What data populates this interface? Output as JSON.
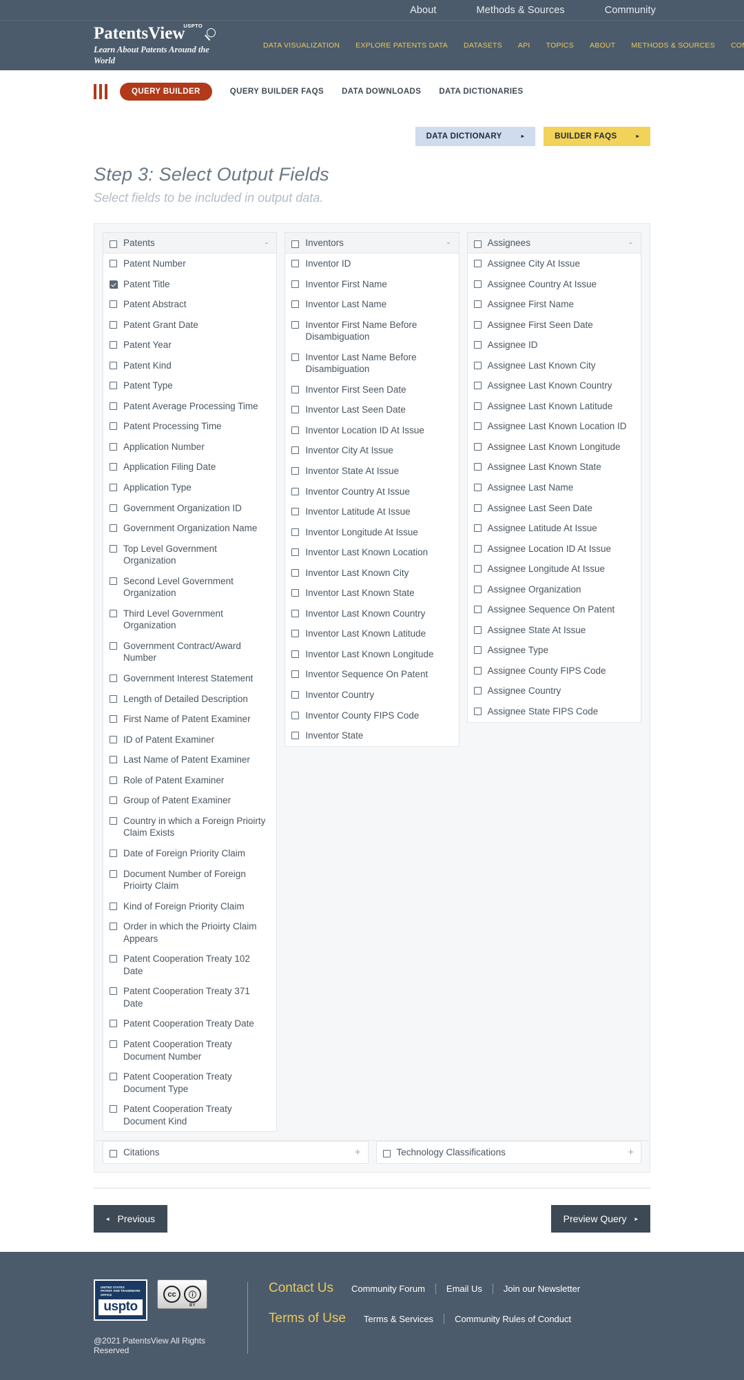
{
  "utility_nav": [
    {
      "label": "About"
    },
    {
      "label": "Methods & Sources"
    },
    {
      "label": "Community"
    }
  ],
  "brand": {
    "name": "PatentsView",
    "superscript": "USPTO",
    "tagline": "Learn About Patents Around the World"
  },
  "main_nav": [
    {
      "label": "DATA VISUALIZATION"
    },
    {
      "label": "EXPLORE PATENTS DATA"
    },
    {
      "label": "DATASETS"
    },
    {
      "label": "API"
    },
    {
      "label": "TOPICS"
    },
    {
      "label": "ABOUT"
    },
    {
      "label": "METHODS & SOURCES"
    },
    {
      "label": "COMMUNITY"
    }
  ],
  "subnav": {
    "active": "QUERY BUILDER",
    "links": [
      {
        "label": "QUERY BUILDER FAQS"
      },
      {
        "label": "DATA DOWNLOADS"
      },
      {
        "label": "DATA DICTIONARIES"
      }
    ]
  },
  "actions": {
    "data_dictionary": "DATA DICTIONARY",
    "builder_faqs": "BUILDER FAQS",
    "caret": "▸"
  },
  "step": {
    "title": "Step 3: Select Output Fields",
    "subtitle": "Select fields to be included in output data."
  },
  "groups": [
    {
      "name": "Patents",
      "toggle": "-",
      "checked": false,
      "fields": [
        {
          "label": "Patent Number",
          "checked": false
        },
        {
          "label": "Patent Title",
          "checked": true
        },
        {
          "label": "Patent Abstract",
          "checked": false
        },
        {
          "label": "Patent Grant Date",
          "checked": false
        },
        {
          "label": "Patent Year",
          "checked": false
        },
        {
          "label": "Patent Kind",
          "checked": false
        },
        {
          "label": "Patent Type",
          "checked": false
        },
        {
          "label": "Patent Average Processing Time",
          "checked": false
        },
        {
          "label": "Patent Processing Time",
          "checked": false
        },
        {
          "label": "Application Number",
          "checked": false
        },
        {
          "label": "Application Filing Date",
          "checked": false
        },
        {
          "label": "Application Type",
          "checked": false
        },
        {
          "label": "Government Organization ID",
          "checked": false
        },
        {
          "label": "Government Organization Name",
          "checked": false
        },
        {
          "label": "Top Level Government Organization",
          "checked": false
        },
        {
          "label": "Second Level Government Organization",
          "checked": false
        },
        {
          "label": "Third Level Government Organization",
          "checked": false
        },
        {
          "label": "Government Contract/Award Number",
          "checked": false
        },
        {
          "label": "Government Interest Statement",
          "checked": false
        },
        {
          "label": "Length of Detailed Description",
          "checked": false
        },
        {
          "label": "First Name of Patent Examiner",
          "checked": false
        },
        {
          "label": "ID of Patent Examiner",
          "checked": false
        },
        {
          "label": "Last Name of Patent Examiner",
          "checked": false
        },
        {
          "label": "Role of Patent Examiner",
          "checked": false
        },
        {
          "label": "Group of Patent Examiner",
          "checked": false
        },
        {
          "label": "Country in which a Foreign Prioirty Claim Exists",
          "checked": false
        },
        {
          "label": "Date of Foreign Priority Claim",
          "checked": false
        },
        {
          "label": "Document Number of Foreign Prioirty Claim",
          "checked": false
        },
        {
          "label": "Kind of Foreign Priority Claim",
          "checked": false
        },
        {
          "label": "Order in which the Prioirty Claim Appears",
          "checked": false
        },
        {
          "label": "Patent Cooperation Treaty 102 Date",
          "checked": false
        },
        {
          "label": "Patent Cooperation Treaty 371 Date",
          "checked": false
        },
        {
          "label": "Patent Cooperation Treaty Date",
          "checked": false
        },
        {
          "label": "Patent Cooperation Treaty Document Number",
          "checked": false
        },
        {
          "label": "Patent Cooperation Treaty Document Type",
          "checked": false
        },
        {
          "label": "Patent Cooperation Treaty Document Kind",
          "checked": false
        }
      ]
    },
    {
      "name": "Inventors",
      "toggle": "-",
      "checked": false,
      "fields": [
        {
          "label": "Inventor ID",
          "checked": false
        },
        {
          "label": "Inventor First Name",
          "checked": false
        },
        {
          "label": "Inventor Last Name",
          "checked": false
        },
        {
          "label": "Inventor First Name Before Disambiguation",
          "checked": false
        },
        {
          "label": "Inventor Last Name Before Disambiguation",
          "checked": false
        },
        {
          "label": "Inventor First Seen Date",
          "checked": false
        },
        {
          "label": "Inventor Last Seen Date",
          "checked": false
        },
        {
          "label": "Inventor Location ID At Issue",
          "checked": false
        },
        {
          "label": "Inventor City At Issue",
          "checked": false
        },
        {
          "label": "Inventor State At Issue",
          "checked": false
        },
        {
          "label": "Inventor Country At Issue",
          "checked": false
        },
        {
          "label": "Inventor Latitude At Issue",
          "checked": false
        },
        {
          "label": "Inventor Longitude At Issue",
          "checked": false
        },
        {
          "label": "Inventor Last Known Location",
          "checked": false
        },
        {
          "label": "Inventor Last Known City",
          "checked": false
        },
        {
          "label": "Inventor Last Known State",
          "checked": false
        },
        {
          "label": "Inventor Last Known Country",
          "checked": false
        },
        {
          "label": "Inventor Last Known Latitude",
          "checked": false
        },
        {
          "label": "Inventor Last Known Longitude",
          "checked": false
        },
        {
          "label": "Inventor Sequence On Patent",
          "checked": false
        },
        {
          "label": "Inventor Country",
          "checked": false
        },
        {
          "label": "Inventor County FIPS Code",
          "checked": false
        },
        {
          "label": "Inventor State",
          "checked": false
        }
      ]
    },
    {
      "name": "Assignees",
      "toggle": "-",
      "checked": false,
      "fields": [
        {
          "label": "Assignee City At Issue",
          "checked": false
        },
        {
          "label": "Assignee Country At Issue",
          "checked": false
        },
        {
          "label": "Assignee First Name",
          "checked": false
        },
        {
          "label": "Assignee First Seen Date",
          "checked": false
        },
        {
          "label": "Assignee ID",
          "checked": false
        },
        {
          "label": "Assignee Last Known City",
          "checked": false
        },
        {
          "label": "Assignee Last Known Country",
          "checked": false
        },
        {
          "label": "Assignee Last Known Latitude",
          "checked": false
        },
        {
          "label": "Assignee Last Known Location ID",
          "checked": false
        },
        {
          "label": "Assignee Last Known Longitude",
          "checked": false
        },
        {
          "label": "Assignee Last Known State",
          "checked": false
        },
        {
          "label": "Assignee Last Name",
          "checked": false
        },
        {
          "label": "Assignee Last Seen Date",
          "checked": false
        },
        {
          "label": "Assignee Latitude At Issue",
          "checked": false
        },
        {
          "label": "Assignee Location ID At Issue",
          "checked": false
        },
        {
          "label": "Assignee Longitude At Issue",
          "checked": false
        },
        {
          "label": "Assignee Organization",
          "checked": false
        },
        {
          "label": "Assignee Sequence On Patent",
          "checked": false
        },
        {
          "label": "Assignee State At Issue",
          "checked": false
        },
        {
          "label": "Assignee Type",
          "checked": false
        },
        {
          "label": "Assignee County FIPS Code",
          "checked": false
        },
        {
          "label": "Assignee Country",
          "checked": false
        },
        {
          "label": "Assignee State FIPS Code",
          "checked": false
        }
      ]
    }
  ],
  "collapsed_groups": [
    {
      "name": "Citations",
      "toggle": "+",
      "checked": false
    },
    {
      "name": "Technology Classifications",
      "toggle": "+",
      "checked": false
    }
  ],
  "nav_buttons": {
    "previous": "Previous",
    "previous_arrow": "◂",
    "preview": "Preview Query",
    "preview_arrow": "▸"
  },
  "footer": {
    "uspto_logo_line1": "UNITED STATES",
    "uspto_logo_line2": "PATENT AND TRADEMARK OFFICE",
    "uspto_logo_word": "uspto",
    "cc_mark": "cc",
    "cc_by": "BY",
    "copyright": "@2021 PatentsView All Rights Reserved",
    "row1_head": "Contact Us",
    "row1_links": [
      {
        "label": "Community Forum"
      },
      {
        "label": "Email Us"
      },
      {
        "label": "Join our Newsletter"
      }
    ],
    "row2_head": "Terms of Use",
    "row2_links": [
      {
        "label": "Terms & Services"
      },
      {
        "label": "Community Rules of Conduct"
      }
    ]
  },
  "colors": {
    "header_bg": "#4c5b6b",
    "accent_gold": "#e8c95e",
    "accent_red": "#b03a1a",
    "dict_btn": "#cfdcee",
    "faq_btn": "#f2d259",
    "navbtn": "#3d4a56"
  }
}
